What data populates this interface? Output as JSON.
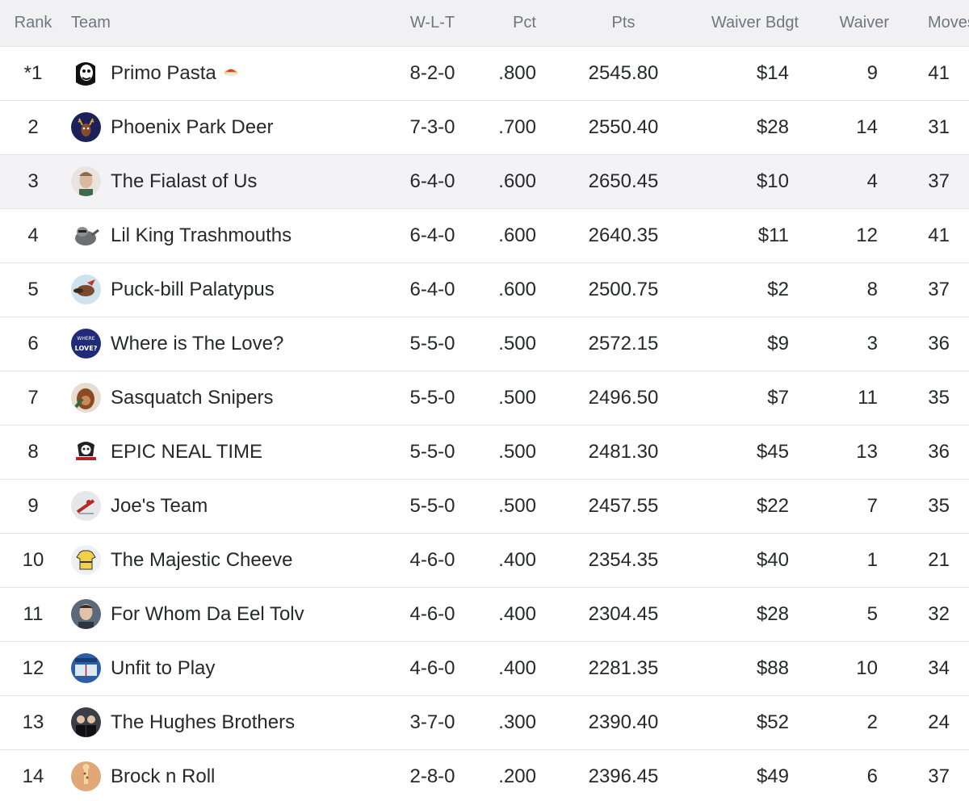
{
  "headers": {
    "rank": "Rank",
    "team": "Team",
    "wlt": "W-L-T",
    "pct": "Pct",
    "pts": "Pts",
    "bdgt": "Waiver Bdgt",
    "waiver": "Waiver",
    "moves": "Moves"
  },
  "rows": [
    {
      "rank": "*1",
      "team": "Primo Pasta",
      "wlt": "8-2-0",
      "pct": ".800",
      "pts": "2545.80",
      "bdgt": "$14",
      "waiver": "9",
      "moves": "41",
      "avatar_icon": "portrait-bw-icon",
      "has_badge": true
    },
    {
      "rank": "2",
      "team": "Phoenix Park Deer",
      "wlt": "7-3-0",
      "pct": ".700",
      "pts": "2550.40",
      "bdgt": "$28",
      "waiver": "14",
      "moves": "31",
      "avatar_icon": "deer-logo-icon"
    },
    {
      "rank": "3",
      "team": "The Fialast of Us",
      "wlt": "6-4-0",
      "pct": ".600",
      "pts": "2650.45",
      "bdgt": "$10",
      "waiver": "4",
      "moves": "37",
      "avatar_icon": "face-portrait-icon"
    },
    {
      "rank": "4",
      "team": "Lil King Trashmouths",
      "wlt": "6-4-0",
      "pct": ".600",
      "pts": "2640.35",
      "bdgt": "$11",
      "waiver": "12",
      "moves": "41",
      "avatar_icon": "raccoon-icon"
    },
    {
      "rank": "5",
      "team": "Puck-bill Palatypus",
      "wlt": "6-4-0",
      "pct": ".600",
      "pts": "2500.75",
      "bdgt": "$2",
      "waiver": "8",
      "moves": "37",
      "avatar_icon": "platypus-icon"
    },
    {
      "rank": "6",
      "team": "Where is The Love?",
      "wlt": "5-5-0",
      "pct": ".500",
      "pts": "2572.15",
      "bdgt": "$9",
      "waiver": "3",
      "moves": "36",
      "avatar_icon": "love-badge-icon"
    },
    {
      "rank": "7",
      "team": "Sasquatch Snipers",
      "wlt": "5-5-0",
      "pct": ".500",
      "pts": "2496.50",
      "bdgt": "$7",
      "waiver": "11",
      "moves": "35",
      "avatar_icon": "sasquatch-icon"
    },
    {
      "rank": "8",
      "team": "EPIC NEAL TIME",
      "wlt": "5-5-0",
      "pct": ".500",
      "pts": "2481.30",
      "bdgt": "$45",
      "waiver": "13",
      "moves": "36",
      "avatar_icon": "skull-logo-icon"
    },
    {
      "rank": "9",
      "team": "Joe's Team",
      "wlt": "5-5-0",
      "pct": ".500",
      "pts": "2457.55",
      "bdgt": "$22",
      "waiver": "7",
      "moves": "35",
      "avatar_icon": "hockey-player-icon"
    },
    {
      "rank": "10",
      "team": "The Majestic Cheeve",
      "wlt": "4-6-0",
      "pct": ".400",
      "pts": "2354.35",
      "bdgt": "$40",
      "waiver": "1",
      "moves": "21",
      "avatar_icon": "jersey-icon"
    },
    {
      "rank": "11",
      "team": "For Whom Da Eel Tolv",
      "wlt": "4-6-0",
      "pct": ".400",
      "pts": "2304.45",
      "bdgt": "$28",
      "waiver": "5",
      "moves": "32",
      "avatar_icon": "person-portrait-icon"
    },
    {
      "rank": "12",
      "team": "Unfit to Play",
      "wlt": "4-6-0",
      "pct": ".400",
      "pts": "2281.35",
      "bdgt": "$88",
      "waiver": "10",
      "moves": "34",
      "avatar_icon": "hockey-rink-icon"
    },
    {
      "rank": "13",
      "team": "The Hughes Brothers",
      "wlt": "3-7-0",
      "pct": ".300",
      "pts": "2390.40",
      "bdgt": "$52",
      "waiver": "2",
      "moves": "24",
      "avatar_icon": "two-people-icon"
    },
    {
      "rank": "14",
      "team": "Brock n Roll",
      "wlt": "2-8-0",
      "pct": ".200",
      "pts": "2396.45",
      "bdgt": "$49",
      "waiver": "6",
      "moves": "37",
      "avatar_icon": "giraffe-icon"
    }
  ],
  "highlighted_row": 3,
  "colors": {
    "header_bg": "#f1f1f3",
    "header_text": "#6e7780",
    "row_text": "#26282a",
    "border": "#e0e4e9",
    "highlight_bg": "#f3f3f5"
  }
}
